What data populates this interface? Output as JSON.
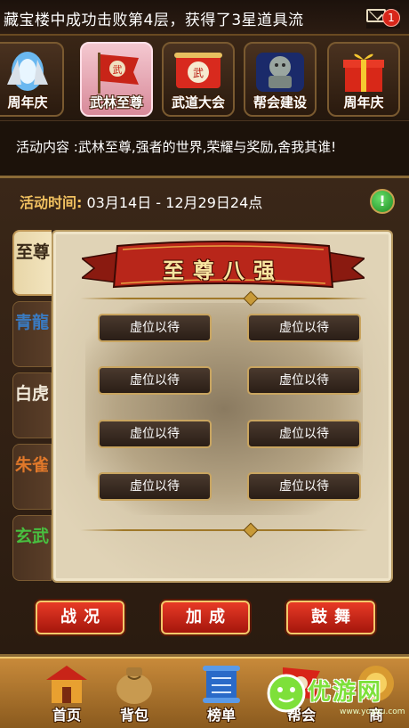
{
  "marquee": {
    "text": "藏宝楼中成功击败第4层，获得了3星道具流",
    "mail_count": "1"
  },
  "event_tabs": [
    {
      "label": "周年庆",
      "icon": "anniversary-crystal-icon"
    },
    {
      "label": "武林至尊",
      "icon": "martial-flag-icon",
      "active": true
    },
    {
      "label": "武道大会",
      "icon": "scroll-banner-icon"
    },
    {
      "label": "帮会建设",
      "icon": "stone-lion-icon"
    },
    {
      "label": "周年庆",
      "icon": "gift-box-icon"
    }
  ],
  "description": "活动内容 :武林至尊,强者的世界,荣耀与奖励,舍我其谁!",
  "activity_time": {
    "label": "活动时间:",
    "value": "03月14日 - 12月29日24点"
  },
  "side_tabs": [
    {
      "label": "至尊",
      "color": "#3a2a18",
      "active": true
    },
    {
      "label": "青龍",
      "color": "#2a6aa8"
    },
    {
      "label": "白虎",
      "color": "#f0e8d8"
    },
    {
      "label": "朱雀",
      "color": "#e0782a"
    },
    {
      "label": "玄武",
      "color": "#48c040"
    }
  ],
  "panel": {
    "title": "至尊八强",
    "slots": [
      "虚位以待",
      "虚位以待",
      "虚位以待",
      "虚位以待",
      "虚位以待",
      "虚位以待",
      "虚位以待",
      "虚位以待"
    ]
  },
  "actions": {
    "battle": "战况",
    "buff": "加成",
    "cheer": "鼓舞"
  },
  "nav": [
    {
      "label": "首页",
      "icon": "palace-icon"
    },
    {
      "label": "背包",
      "icon": "bag-icon"
    },
    {
      "label": "榜单",
      "icon": "scroll-list-icon"
    },
    {
      "label": "帮会",
      "icon": "guild-banner-icon"
    },
    {
      "label": "商",
      "icon": "shop-icon"
    }
  ],
  "watermark": {
    "text": "优游网",
    "sub": "www.yoyou.com"
  },
  "colors": {
    "accent_gold": "#c9a560",
    "button_red": "#c8241a",
    "time_label": "#f0c060"
  }
}
